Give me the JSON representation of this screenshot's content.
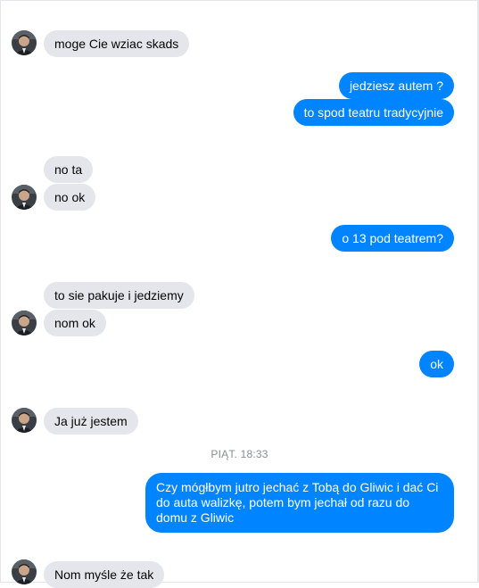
{
  "conversation": {
    "messages": [
      {
        "id": "m1",
        "side": "in",
        "text": "moge Cie wziac skads"
      },
      {
        "id": "m2",
        "side": "out",
        "text": "jedziesz autem ?"
      },
      {
        "id": "m3",
        "side": "out",
        "text": "to spod teatru tradycyjnie"
      },
      {
        "id": "m4",
        "side": "in",
        "text": "no ta"
      },
      {
        "id": "m5",
        "side": "in",
        "text": "no ok"
      },
      {
        "id": "m6",
        "side": "out",
        "text": "o 13 pod teatrem?"
      },
      {
        "id": "m7",
        "side": "in",
        "text": "to sie pakuje i jedziemy"
      },
      {
        "id": "m8",
        "side": "in",
        "text": "nom ok"
      },
      {
        "id": "m9",
        "side": "out",
        "text": "ok"
      },
      {
        "id": "m10",
        "side": "in",
        "text": "Ja już jestem"
      },
      {
        "id": "m11",
        "side": "out",
        "text": "Czy mógłbym jutro jechać z Tobą do Gliwic i dać Ci do auta walizkę, potem bym jechał od razu do domu z Gliwic"
      },
      {
        "id": "m12",
        "side": "in",
        "text": "Nom myśle że tak"
      }
    ],
    "timestamp": "PIĄT. 18:33"
  },
  "colors": {
    "outgoing": "#0084ff",
    "incoming": "#e4e6eb",
    "timestamp": "#8a8d91"
  },
  "icons": {
    "avatar": "contact-avatar-icon"
  }
}
